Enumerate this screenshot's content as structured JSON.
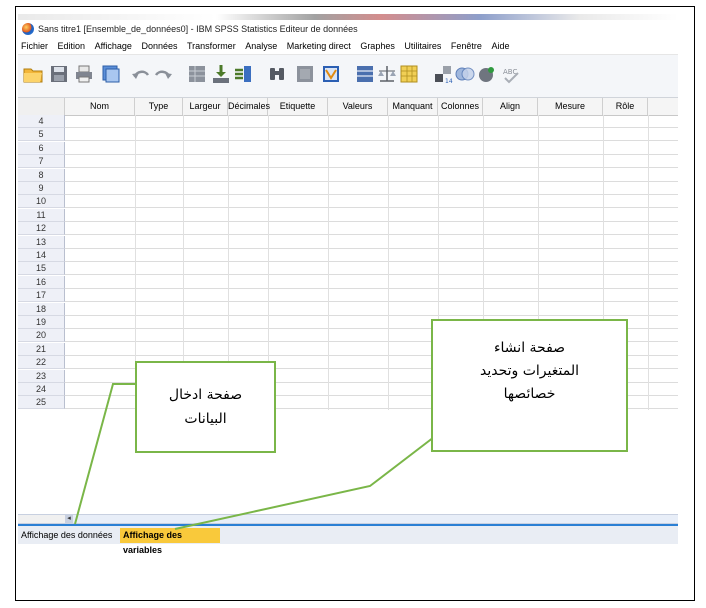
{
  "window": {
    "title": "Sans titre1 [Ensemble_de_données0] - IBM SPSS Statistics Editeur de données"
  },
  "menu": [
    "Fichier",
    "Edition",
    "Affichage",
    "Données",
    "Transformer",
    "Analyse",
    "Marketing direct",
    "Graphes",
    "Utilitaires",
    "Fenêtre",
    "Aide"
  ],
  "toolbar_icons": [
    "open-folder-icon",
    "save-icon",
    "print-icon",
    "dialog-recall-icon",
    "undo-icon",
    "redo-icon",
    "goto-case-icon",
    "goto-variable-icon",
    "variables-icon",
    "find-icon",
    "insert-cases-icon",
    "insert-variable-icon",
    "split-file-icon",
    "weight-cases-icon",
    "select-cases-icon",
    "value-labels-icon",
    "use-sets-icon",
    "show-all-icon",
    "spell-check-icon"
  ],
  "grid": {
    "columns": [
      "Nom",
      "Type",
      "Largeur",
      "Décimales",
      "Etiquette",
      "Valeurs",
      "Manquant",
      "Colonnes",
      "Align",
      "Mesure",
      "Rôle"
    ],
    "rows": [
      "4",
      "5",
      "6",
      "7",
      "8",
      "9",
      "10",
      "11",
      "12",
      "13",
      "14",
      "15",
      "16",
      "17",
      "18",
      "19",
      "20",
      "21",
      "22",
      "23",
      "24",
      "25"
    ]
  },
  "tabs": {
    "data_view": "Affichage des données",
    "variable_view": "Affichage des variables"
  },
  "callouts": {
    "left_line1": "صفحة ادخال",
    "left_line2": "البيانات",
    "right_line1": "صفحة انشاء",
    "right_line2": "المتغيرات وتحديد",
    "right_line3": "خصائصها"
  },
  "colors": {
    "callout_border": "#7ab648",
    "active_tab": "#f9c93b",
    "tab_accent": "#2a7fd4"
  }
}
